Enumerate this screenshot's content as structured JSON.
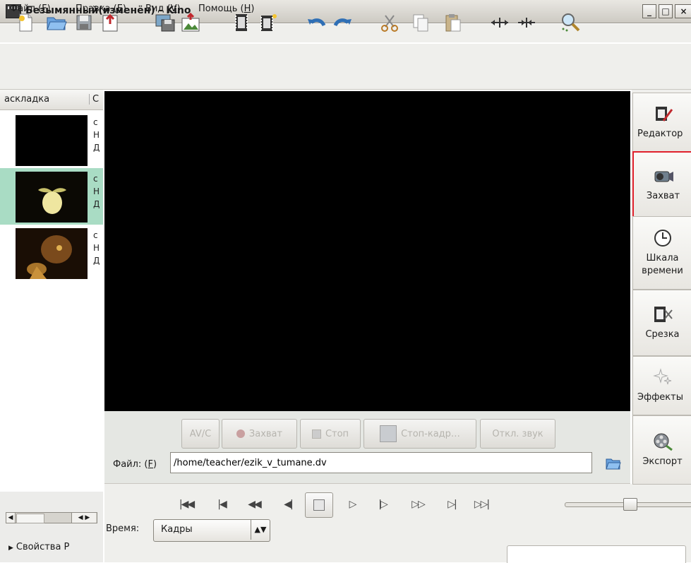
{
  "window": {
    "title": "Безымянный(изменён) - Kino",
    "controls": [
      "_",
      "□",
      "×"
    ]
  },
  "menu": [
    {
      "label": "Файл (",
      "key": "F",
      "end": ")"
    },
    {
      "label": "Правка (",
      "key": "E",
      "end": ")"
    },
    {
      "label": "Вид (",
      "key": "V",
      "end": ")"
    },
    {
      "label": "Помощь (",
      "key": "H",
      "end": ")"
    }
  ],
  "toolbar": {
    "icons": [
      "new-file-icon",
      "open-folder-icon",
      "save-icon",
      "export-icon",
      "save-frame-icon",
      "image-icon",
      "film-insert-icon",
      "film-append-icon",
      "undo-icon",
      "redo-icon",
      "cut-icon",
      "copy-icon",
      "paste-icon",
      "split-icon",
      "join-icon",
      "zoom-icon"
    ]
  },
  "storyboard": {
    "columns": [
      "аскладка",
      "С"
    ],
    "clips": [
      {
        "lines": [
          "с",
          "Н",
          "Д"
        ],
        "selected": false,
        "thumb": "black"
      },
      {
        "lines": [
          "с",
          "Н",
          "Д"
        ],
        "selected": true,
        "thumb": "fruit"
      },
      {
        "lines": [
          "с",
          "Н",
          "Д"
        ],
        "selected": false,
        "thumb": "hedgehog"
      }
    ],
    "properties": "Свойства Р"
  },
  "capture": {
    "buttons": {
      "avc": "AV/C",
      "capture": "Захват",
      "stop": "Стоп",
      "still": "Стоп-кадр…",
      "mute": "Откл. звук"
    },
    "file_label": "Файл: (",
    "file_label_key": "F",
    "file_label_end": ")",
    "file_path": "/home/teacher/ezik_v_tumane.dv"
  },
  "transport": {
    "time_label": "Время:",
    "time_mode": "Кадры"
  },
  "nav": {
    "items": [
      {
        "label": "Редактор",
        "icon": "editor-icon",
        "selected": false
      },
      {
        "label": "Захват",
        "icon": "camcorder-icon",
        "selected": true
      },
      {
        "label": "Шкала\nвремени",
        "icon": "clock-icon",
        "selected": false
      },
      {
        "label": "Срезка",
        "icon": "trim-icon",
        "selected": false
      },
      {
        "label": "Эффекты",
        "icon": "sparkle-icon",
        "selected": false
      },
      {
        "label": "Экспорт",
        "icon": "film-reel-icon",
        "selected": false
      }
    ]
  }
}
